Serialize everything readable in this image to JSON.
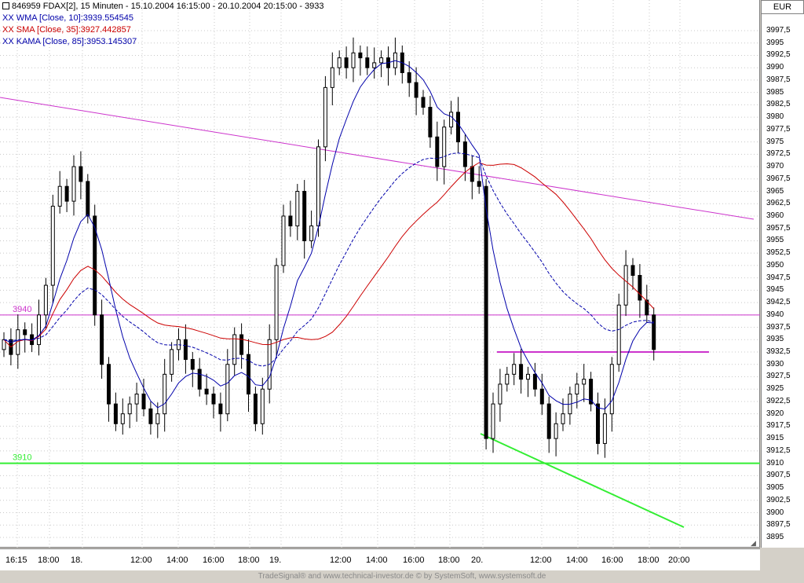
{
  "legend": {
    "title": "846959  FDAX[2], 15 Minuten - 15.10.2004 16:15:00 - 20.10.2004 20:15:00 - 3933",
    "wma": "XX WMA [Close, 10]:3939.554545",
    "sma": "XX SMA [Close, 35]:3927.442857",
    "kama": "XX KAMA [Close, 85]:3953.145307"
  },
  "currency": "EUR",
  "footer": "TradeSignal® and www.technical-investor.de © by SystemSoft, www.systemsoft.de",
  "chart_data": {
    "type": "candlestick",
    "symbol": "FDAX[2]",
    "interval": "15 Minuten",
    "ylim": [
      3895,
      3998
    ],
    "y_ticks": [
      "3997,5",
      "3995",
      "3992,5",
      "3990",
      "3987,5",
      "3985",
      "3982,5",
      "3980",
      "3977,5",
      "3975",
      "3972,5",
      "3970",
      "3967,5",
      "3965",
      "3962,5",
      "3960",
      "3957,5",
      "3955",
      "3952,5",
      "3950",
      "3947,5",
      "3945",
      "3942,5",
      "3940",
      "3937,5",
      "3935",
      "3932,5",
      "3930",
      "3927,5",
      "3925",
      "3922,5",
      "3920",
      "3917,5",
      "3915",
      "3912,5",
      "3910",
      "3907,5",
      "3905",
      "3902,5",
      "3900",
      "3897,5",
      "3895"
    ],
    "x_ticks": [
      "16:15",
      "18:00",
      "18.",
      "12:00",
      "14:00",
      "16:00",
      "18:00",
      "19.",
      "12:00",
      "14:00",
      "16:00",
      "18:00",
      "20.",
      "12:00",
      "14:00",
      "16:00",
      "18:00",
      "20:00"
    ],
    "horizontal_lines": [
      {
        "label": "3940",
        "value": 3940,
        "color": "#cc33cc"
      },
      {
        "label": "3910",
        "value": 3910,
        "color": "#33ee33"
      }
    ],
    "colors": {
      "wma": "#0000aa",
      "sma": "#cc0000",
      "kama": "#0000aa",
      "trend_magenta": "#cc33cc",
      "trend_green": "#33ee33",
      "candle": "#000000"
    },
    "close_series": [
      3935,
      3932,
      3937,
      3936,
      3934,
      3940,
      3946,
      3962,
      3966,
      3963,
      3970,
      3967,
      3960,
      3940,
      3930,
      3922,
      3918,
      3920,
      3922,
      3924,
      3921,
      3918,
      3920,
      3928,
      3933,
      3935,
      3931,
      3929,
      3925,
      3924,
      3922,
      3920,
      3930,
      3936,
      3932,
      3924,
      3918,
      3925,
      3935,
      3950,
      3960,
      3958,
      3965,
      3955,
      3958,
      3974,
      3986,
      3990,
      3992,
      3990,
      3993,
      3992,
      3990,
      3991,
      3992,
      3990,
      3993,
      3989,
      3987,
      3984,
      3982,
      3976,
      3970,
      3978,
      3981,
      3975,
      3970,
      3967,
      3966,
      3915,
      3922,
      3926,
      3928,
      3930,
      3927,
      3928,
      3925,
      3922,
      3915,
      3918,
      3920,
      3924,
      3926,
      3927,
      3922,
      3914,
      3920,
      3930,
      3942,
      3950,
      3948,
      3943,
      3940,
      3933
    ]
  }
}
